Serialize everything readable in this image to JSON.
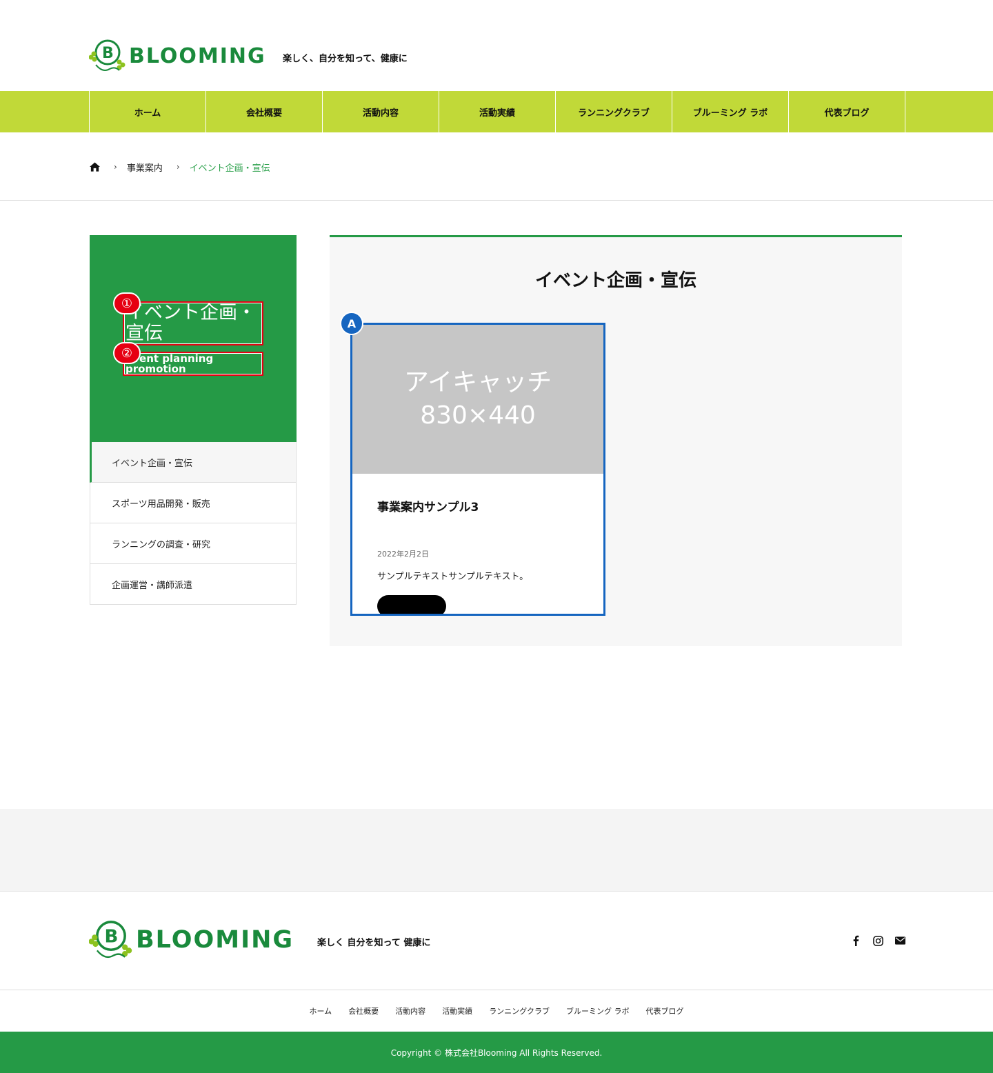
{
  "header": {
    "logo_text": "BLOOMING",
    "tagline": "楽しく、自分を知って、健康に"
  },
  "gnav": {
    "items": [
      {
        "label": "ホーム"
      },
      {
        "label": "会社概要"
      },
      {
        "label": "活動内容"
      },
      {
        "label": "活動実績"
      },
      {
        "label": "ランニングクラブ"
      },
      {
        "label": "ブルーミング ラボ"
      },
      {
        "label": "代表ブログ"
      }
    ]
  },
  "breadcrumb": {
    "home_icon": "home-icon",
    "items": [
      {
        "label": "事業案内"
      },
      {
        "label": "イベント企画・宣伝"
      }
    ]
  },
  "sidebar": {
    "title": "イベント企画・宣伝",
    "subtitle": "Event planning promotion",
    "markers": [
      "①",
      "②"
    ],
    "items": [
      {
        "label": "イベント企画・宣伝",
        "active": true
      },
      {
        "label": "スポーツ用品開発・販売"
      },
      {
        "label": "ランニングの調査・研究"
      },
      {
        "label": "企画運営・講師派遣"
      }
    ]
  },
  "main": {
    "title": "イベント企画・宣伝",
    "card": {
      "marker": "A",
      "image_line1": "アイキャッチ",
      "image_line2": "830×440",
      "title": "事業案内サンプル3",
      "date": "2022年2月2日",
      "text": "サンプルテキストサンプルテキスト。"
    }
  },
  "footer": {
    "logo_text": "BLOOMING",
    "tagline": "楽しく 自分を知って 健康に",
    "social_icons": [
      "facebook-icon",
      "instagram-icon",
      "mail-icon"
    ],
    "nav": [
      {
        "label": "ホーム"
      },
      {
        "label": "会社概要"
      },
      {
        "label": "活動内容"
      },
      {
        "label": "活動実績"
      },
      {
        "label": "ランニングクラブ"
      },
      {
        "label": "ブルーミング ラボ"
      },
      {
        "label": "代表ブログ"
      }
    ],
    "copyright": "Copyright © 株式会社Blooming All Rights Reserved."
  },
  "colors": {
    "brand_green": "#259a46",
    "nav_lime": "#c1d938",
    "marker_red": "#e60012",
    "marker_blue": "#1565c0"
  }
}
